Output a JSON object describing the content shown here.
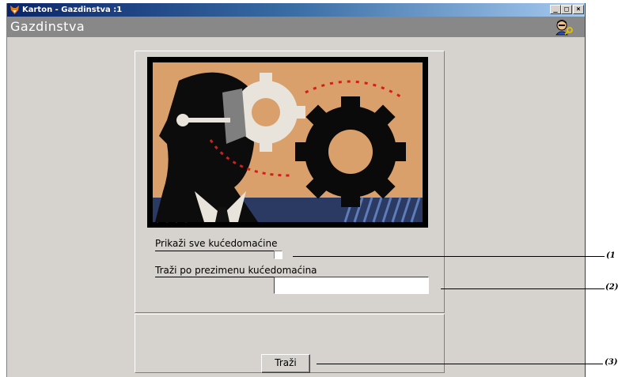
{
  "window": {
    "title": "Karton - Gazdinstva :1",
    "controls": {
      "minimize": "_",
      "maximize": "□",
      "close": "×"
    }
  },
  "header": {
    "title": "Gazdinstva",
    "icon": "user-key-icon"
  },
  "form": {
    "show_all_label": "Prikaži sve kućedomaćine",
    "show_all_checked": false,
    "search_label": "Traži po prezimenu kućedomaćina",
    "search_value": "",
    "search_button_label": "Traži"
  },
  "callouts": [
    "(1",
    "(2)",
    "(3)"
  ],
  "colors": {
    "title_bar": "#0a246a",
    "header_bar": "#888888",
    "window_bg": "#d6d3ce",
    "illustration_bg": "#d9a06b"
  }
}
